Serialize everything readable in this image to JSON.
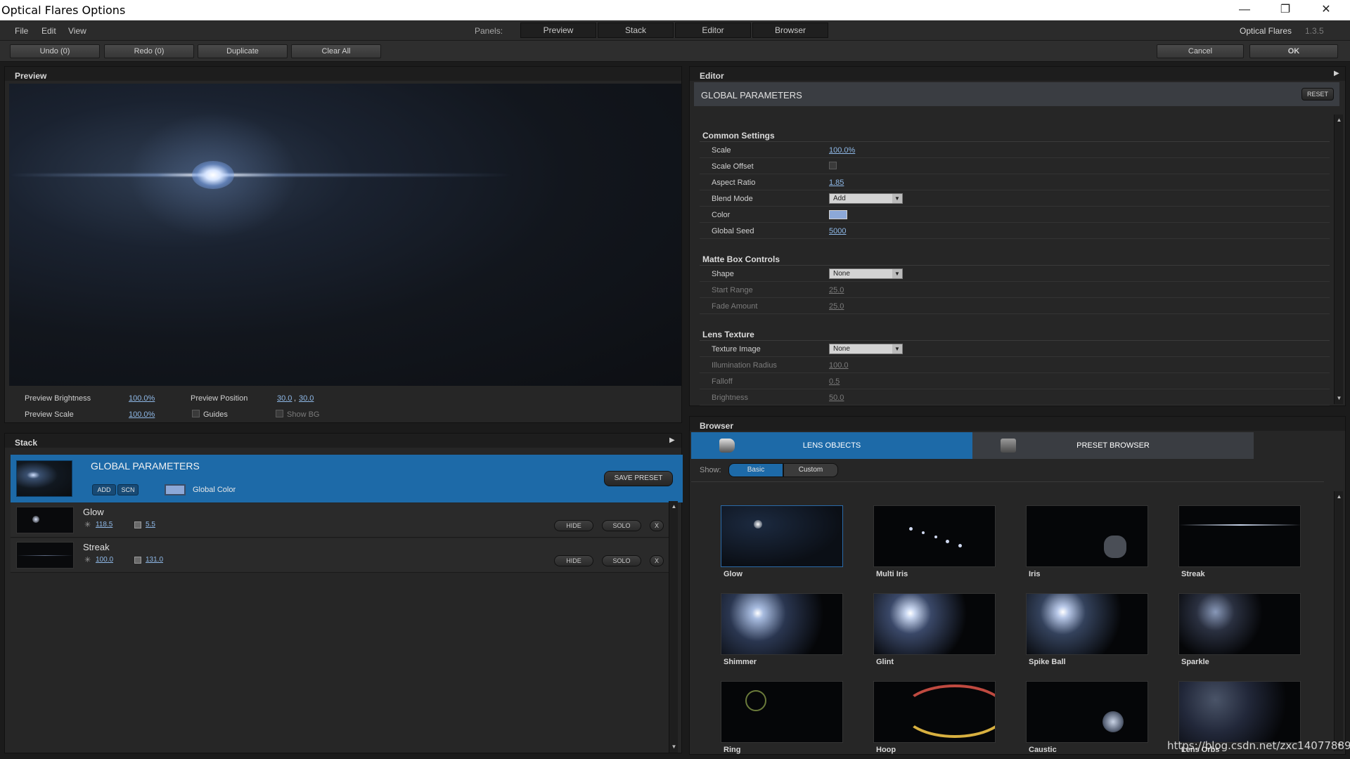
{
  "window": {
    "title": "Optical Flares Options",
    "minimize": "—",
    "restore": "❐",
    "close": "✕"
  },
  "menu": [
    "File",
    "Edit",
    "View"
  ],
  "panels": {
    "label": "Panels:",
    "tabs": [
      "Preview",
      "Stack",
      "Editor",
      "Browser"
    ]
  },
  "brand": {
    "name": "Optical Flares",
    "version": "1.3.5"
  },
  "toolbar": {
    "undo": "Undo (0)",
    "redo": "Redo (0)",
    "duplicate": "Duplicate",
    "clear_all": "Clear All",
    "cancel": "Cancel",
    "ok": "OK"
  },
  "preview": {
    "title": "Preview",
    "brightness_label": "Preview Brightness",
    "brightness": "100.0%",
    "position_label": "Preview Position",
    "position_x": "30.0",
    "position_y": "30.0",
    "scale_label": "Preview Scale",
    "scale": "100.0%",
    "guides_label": "Guides",
    "show_bg_label": "Show BG"
  },
  "stack": {
    "title": "Stack",
    "global": {
      "title": "GLOBAL PARAMETERS",
      "add": "ADD",
      "scn": "SCN",
      "color_label": "Global Color",
      "save_preset": "SAVE PRESET",
      "color": "#8ca8d8"
    },
    "layers": [
      {
        "name": "Glow",
        "brightness": "118.5",
        "scale": "5.5",
        "hide": "HIDE",
        "solo": "SOLO",
        "remove": "X"
      },
      {
        "name": "Streak",
        "brightness": "100.0",
        "scale": "131.0",
        "hide": "HIDE",
        "solo": "SOLO",
        "remove": "X"
      }
    ]
  },
  "editor": {
    "title": "Editor",
    "header": "GLOBAL PARAMETERS",
    "reset": "RESET",
    "sections": {
      "common": {
        "title": "Common Settings",
        "scale_label": "Scale",
        "scale": "100.0%",
        "scale_offset_label": "Scale Offset",
        "aspect_label": "Aspect Ratio",
        "aspect": "1.85",
        "blend_label": "Blend Mode",
        "blend": "Add",
        "color_label": "Color",
        "seed_label": "Global Seed",
        "seed": "5000"
      },
      "matte": {
        "title": "Matte Box Controls",
        "shape_label": "Shape",
        "shape": "None",
        "start_label": "Start Range",
        "start": "25.0",
        "fade_label": "Fade Amount",
        "fade": "25.0"
      },
      "texture": {
        "title": "Lens Texture",
        "image_label": "Texture Image",
        "image": "None",
        "radius_label": "Illumination Radius",
        "radius": "100.0",
        "falloff_label": "Falloff",
        "falloff": "0.5",
        "brightness_label": "Brightness",
        "brightness": "50.0"
      }
    }
  },
  "browser": {
    "title": "Browser",
    "tab_lens": "LENS OBJECTS",
    "tab_preset": "PRESET BROWSER",
    "show_label": "Show:",
    "show_basic": "Basic",
    "show_custom": "Custom",
    "items": [
      "Glow",
      "Multi Iris",
      "Iris",
      "Streak",
      "Shimmer",
      "Glint",
      "Spike Ball",
      "Sparkle",
      "Ring",
      "Hoop",
      "Caustic",
      "Lens Orbs"
    ]
  },
  "watermark": "https://blog.csdn.net/zxc140778897"
}
